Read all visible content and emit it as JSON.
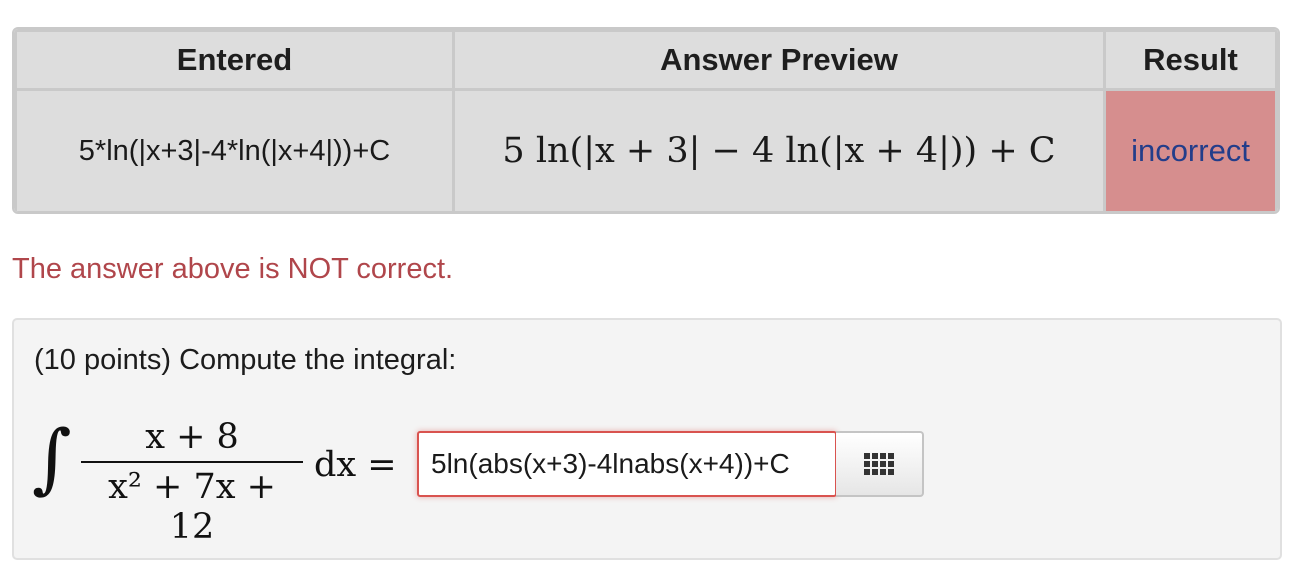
{
  "results_table": {
    "headers": {
      "entered": "Entered",
      "preview": "Answer Preview",
      "result": "Result"
    },
    "row": {
      "entered": "5*ln(|x+3|-4*ln(|x+4|))+C",
      "preview": "5 ln(|x + 3| − 4 ln(|x + 4|)) + C",
      "result": "incorrect"
    },
    "result_color": "#d68e8e",
    "result_text_color": "#233d8a"
  },
  "feedback": {
    "message": "The answer above is NOT correct.",
    "color": "#b0464b"
  },
  "problem": {
    "statement": "(10 points) Compute the integral:",
    "integrand": {
      "numerator": "x + 8",
      "denominator": "x² + 7x + 12",
      "differential": "dx ="
    },
    "answer_input": {
      "value": "5ln(abs(x+3)-4lnabs(x+4))+C",
      "border_color": "#d9534f"
    },
    "palette_button_icon": "grid-icon"
  }
}
